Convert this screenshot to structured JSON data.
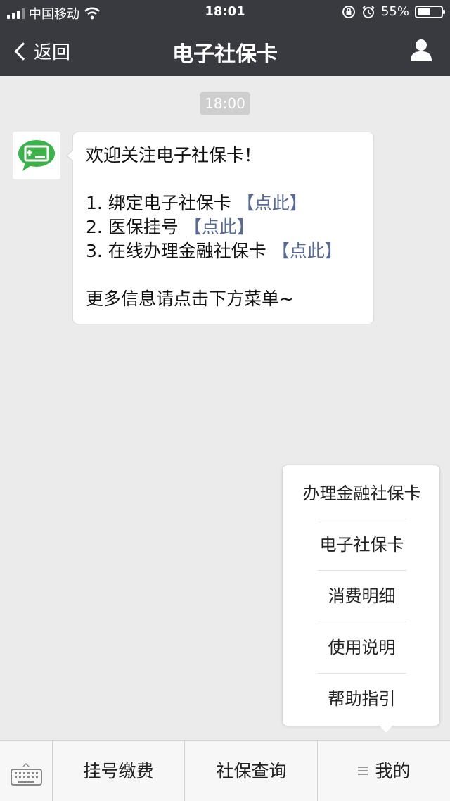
{
  "status_bar": {
    "carrier": "中国移动",
    "time": "18:01",
    "battery_percent": "55%",
    "battery_level": 0.55,
    "icons": [
      "signal-icon",
      "wifi-icon",
      "orientation-lock-icon",
      "alarm-icon",
      "battery-icon"
    ]
  },
  "nav": {
    "back_label": "返回",
    "title": "电子社保卡",
    "profile_icon": "person-icon"
  },
  "chat": {
    "timestamp": "18:00",
    "avatar_icon": "card-plus-icon",
    "avatar_colors": {
      "outer": "#3bb34a",
      "inner": "#ffffff"
    },
    "message": {
      "greeting": "欢迎关注电子社保卡！",
      "items": [
        {
          "text": "1. 绑定电子社保卡 ",
          "link": "【点此】"
        },
        {
          "text": "2. 医保挂号 ",
          "link": "【点此】"
        },
        {
          "text": "3. 在线办理金融社保卡 ",
          "link": "【点此】"
        }
      ],
      "footer": "更多信息请点击下方菜单~"
    },
    "link_color": "#576b95"
  },
  "popup_menu": {
    "items": [
      "办理金融社保卡",
      "电子社保卡",
      "消费明细",
      "使用说明",
      "帮助指引"
    ]
  },
  "bottom_menu": {
    "keyboard_icon": "keyboard-icon",
    "tabs": [
      "挂号缴费",
      "社保查询",
      "我的"
    ],
    "menu_icon": "menu-lines-icon"
  },
  "colors": {
    "top_bar": "#393a3f",
    "background": "#ebebeb"
  }
}
